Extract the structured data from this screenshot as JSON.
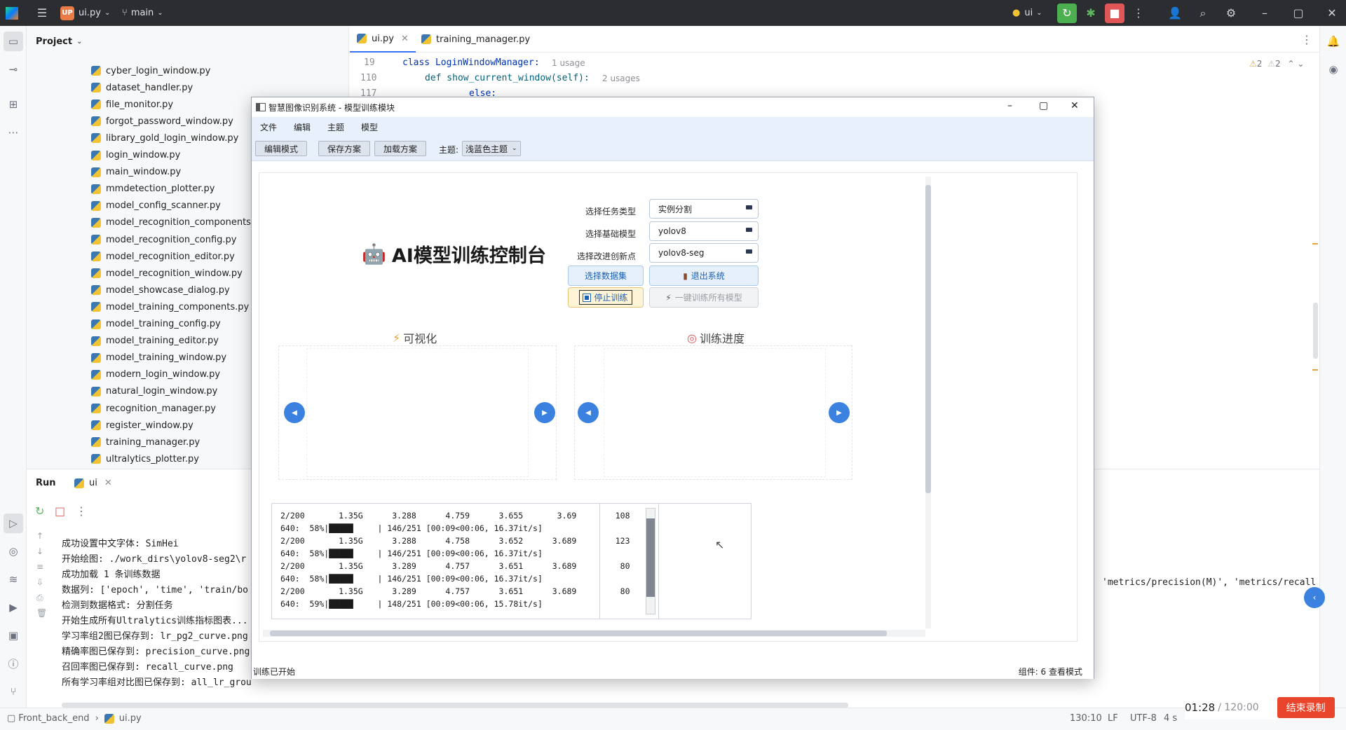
{
  "ide": {
    "project_badge": "UP",
    "file_name": "ui.py",
    "branch": "main",
    "run_config": "ui",
    "tabs": [
      {
        "label": "ui.py"
      },
      {
        "label": "training_manager.py"
      }
    ],
    "panel_title": "Project",
    "inspections": {
      "warnings": "2",
      "weak_warnings": "2"
    }
  },
  "project_files": [
    "cyber_login_window.py",
    "dataset_handler.py",
    "file_monitor.py",
    "forgot_password_window.py",
    "library_gold_login_window.py",
    "login_window.py",
    "main_window.py",
    "mmdetection_plotter.py",
    "model_config_scanner.py",
    "model_recognition_components.py",
    "model_recognition_config.py",
    "model_recognition_editor.py",
    "model_recognition_window.py",
    "model_showcase_dialog.py",
    "model_training_components.py",
    "model_training_config.py",
    "model_training_editor.py",
    "model_training_window.py",
    "modern_login_window.py",
    "natural_login_window.py",
    "recognition_manager.py",
    "register_window.py",
    "training_manager.py",
    "ultralytics_plotter.py"
  ],
  "code": [
    {
      "line": "19",
      "text": "class LoginWindowManager:",
      "hint": "1 usage"
    },
    {
      "line": "110",
      "text": "def show_current_window(self):",
      "hint": "2 usages"
    },
    {
      "line": "117",
      "text": "else:",
      "hint": ""
    }
  ],
  "run": {
    "title": "Run",
    "tab": "ui",
    "logs": [
      "成功设置中文字体: SimHei",
      "开始绘图: ./work_dirs\\yolov8-seg2\\r",
      "成功加载 1 条训练数据",
      "数据列: ['epoch', 'time', 'train/bo",
      "检测到数据格式: 分割任务",
      "开始生成所有Ultralytics训练指标图表...",
      "学习率组2图已保存到: lr_pg2_curve.png",
      "精确率图已保存到: precision_curve.png",
      "召回率图已保存到: recall_curve.png",
      "所有学习率组对比图已保存到: all_lr_grou"
    ],
    "right_text": "'metrics/precision(M)', 'metrics/recall"
  },
  "status_bar": {
    "breadcrumb_root": "Front_back_end",
    "breadcrumb_file": "ui.py",
    "position": "130:10",
    "line_sep": "LF",
    "encoding": "UTF-8",
    "indent": "4 s"
  },
  "recording": {
    "elapsed": "01:28",
    "total": "/ 120:00",
    "stop_label": "结束录制"
  },
  "app": {
    "title": "智慧图像识别系统 - 模型训练模块",
    "menu": [
      "文件",
      "编辑",
      "主题",
      "模型"
    ],
    "toolbar": {
      "edit_mode": "编辑模式",
      "save_plan": "保存方案",
      "load_plan": "加载方案",
      "theme_label": "主题:",
      "theme_value": "浅蓝色主题"
    },
    "console_title": "AI模型训练控制台",
    "fields": [
      {
        "label": "选择任务类型",
        "value": "实例分割"
      },
      {
        "label": "选择基础模型",
        "value": "yolov8"
      },
      {
        "label": "选择改进创新点",
        "value": "yolov8-seg"
      }
    ],
    "buttons": {
      "select_dataset": "选择数据集",
      "exit_system": "退出系统",
      "stop_training": "停止训练",
      "train_all": "一键训练所有模型"
    },
    "visualization_title": "可视化",
    "progress_title": "训练进度",
    "training_log": [
      "2/200       1.35G      3.288      4.759      3.655       3.69        108",
      "640:  58%|█████     | 146/251 [00:09<00:06, 16.37it/s]",
      "2/200       1.35G      3.288      4.758      3.652      3.689        123",
      "640:  58%|█████     | 146/251 [00:09<00:06, 16.37it/s]",
      "2/200       1.35G      3.289      4.757      3.651      3.689         80",
      "640:  58%|█████     | 146/251 [00:09<00:06, 16.37it/s]",
      "2/200       1.35G      3.289      4.757      3.651      3.689         80",
      "640:  59%|█████     | 148/251 [00:09<00:06, 15.78it/s]"
    ],
    "status_left": "训练已开始",
    "status_right": "组件: 6  查看模式"
  }
}
